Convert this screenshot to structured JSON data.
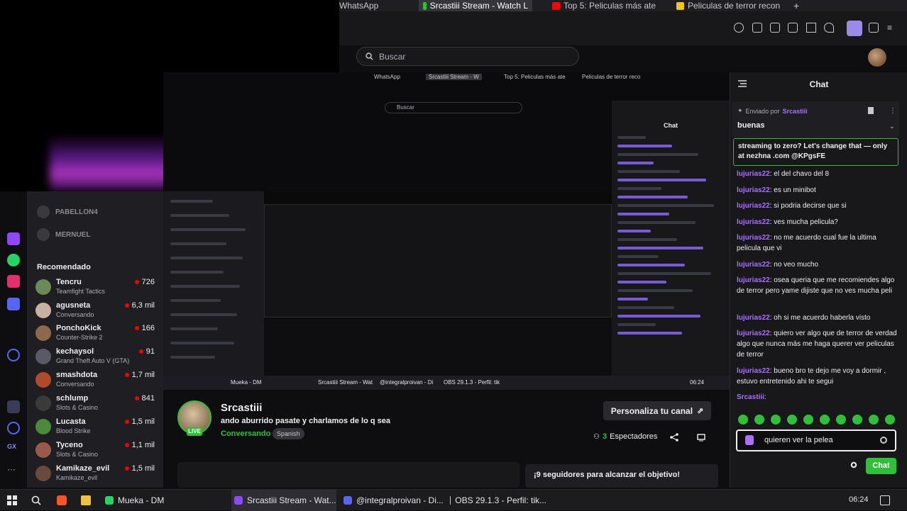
{
  "browser": {
    "tabs": [
      {
        "label": "WhatsApp",
        "favicon_color": "#25d366"
      },
      {
        "label": "Srcastiii Stream - Watch L",
        "favicon_color": "#2fbf3a"
      },
      {
        "label": "Top 5: Peliculas más ate",
        "favicon_color": "#ff0000"
      },
      {
        "label": "Peliculas de terror recon",
        "favicon_color": "#f5c518"
      }
    ],
    "search_placeholder": "Buscar"
  },
  "sidebar": {
    "dim_items": [
      {
        "label": "PABELLON4"
      },
      {
        "label": "MERNUEL"
      }
    ],
    "recommended_title": "Recomendado",
    "channels": [
      {
        "name": "Tencru",
        "game": "Teamfight Tactics",
        "viewers": "726",
        "avatar_color": "#6b8a5a"
      },
      {
        "name": "agusneta",
        "game": "Conversando",
        "viewers": "6,3 mil",
        "avatar_color": "#c9b0a0"
      },
      {
        "name": "PonchoKick",
        "game": "Counter-Strike 2",
        "viewers": "166",
        "avatar_color": "#8a6a4a"
      },
      {
        "name": "kechaysol",
        "game": "Grand Theft Auto V (GTA)",
        "viewers": "91",
        "avatar_color": "#5a5a66"
      },
      {
        "name": "smashdota",
        "game": "Conversando",
        "viewers": "1,7 mil",
        "avatar_color": "#b04a2a"
      },
      {
        "name": "schlump",
        "game": "Slots & Casino",
        "viewers": "841",
        "avatar_color": "#3a3a3a"
      },
      {
        "name": "Lucasta",
        "game": "Blood Strike",
        "viewers": "1,5 mil",
        "avatar_color": "#4a8a3a"
      },
      {
        "name": "Tyceno",
        "game": "Slots & Casino",
        "viewers": "1,1 mil",
        "avatar_color": "#9a5a4a"
      },
      {
        "name": "Kamikaze_evil",
        "game": "Kamikaze_evil",
        "viewers": "1,5 mil",
        "avatar_color": "#6a4a3a"
      }
    ]
  },
  "nested": {
    "tabs": [
      "WhatsApp",
      "Srcastiii Stream - W",
      "Top 5: Peliculas más ate",
      "Peliculas de terror reco"
    ],
    "search_placeholder": "Buscar",
    "chat_title": "Chat",
    "taskbar": [
      "Mueka - DM",
      "Srcastiii Stream - Wat",
      "@integralproivan - Di",
      "OBS 29.1.3 - Perfil: tik"
    ],
    "time": "06:24"
  },
  "channel": {
    "live_label": "LIVE",
    "name": "Srcastiii",
    "title": "ando aburrido pasate y charlamos de lo q sea",
    "category": "Conversando",
    "tag": "Spanish",
    "customize_label": "Personaliza tu canal",
    "viewers_count": "3",
    "viewers_label": "Espectadores",
    "goal_text": "¡9 seguidores para alcanzar el objetivo!"
  },
  "chat": {
    "title": "Chat",
    "pinned_label": "Enviado por",
    "pinned_user": "Srcastiii",
    "pinned_message": "buenas",
    "promo": "streaming to zero? Let's change that — only at nezhna .com @KPgsFE",
    "messages": [
      {
        "user": "lujurias22",
        "text": "el del chavo del 8"
      },
      {
        "user": "lujurias22",
        "text": "es un minibot"
      },
      {
        "user": "lujurias22",
        "text": "si podria decirse que si"
      },
      {
        "user": "lujurias22",
        "text": "ves mucha pelicula?"
      },
      {
        "user": "lujurias22",
        "text": "no me acuerdo cual fue la ultima pelicula que vi"
      },
      {
        "user": "lujurias22",
        "text": "no veo mucho"
      },
      {
        "user": "lujurias22",
        "text": "osea queria que me recomiendes algo de terror pero yame dijiste que no ves mucha peli"
      },
      {
        "user": "lujurias22",
        "text": "oh si me acuerdo haberla visto"
      },
      {
        "user": "lujurias22",
        "text": "quiero ver algo que de terror de verdad algo que nunca más me haga querer ver peliculas de terror"
      },
      {
        "user": "lujurias22",
        "text": "bueno bro te dejo me voy a dormir , estuvo entretenido ahi te segui"
      },
      {
        "user": "Srcastiii",
        "text": ""
      }
    ],
    "input_value": "quieren ver la pelea",
    "send_label": "Chat"
  },
  "taskbar": {
    "apps": [
      {
        "label": "Mueka - DM",
        "color": "#25d366"
      },
      {
        "label": "Srcastiii Stream - Wat...",
        "color": "#9146ff"
      },
      {
        "label": "@integralproivan - Di...",
        "color": "#5865f2"
      },
      {
        "label": "OBS 29.1.3 - Perfil: tik...",
        "color": "#c8c8cc"
      }
    ],
    "time": "06:24"
  },
  "colors": {
    "accent_green": "#2fbf3a",
    "accent_purple": "#a970ff",
    "background": "#0e0e10"
  }
}
